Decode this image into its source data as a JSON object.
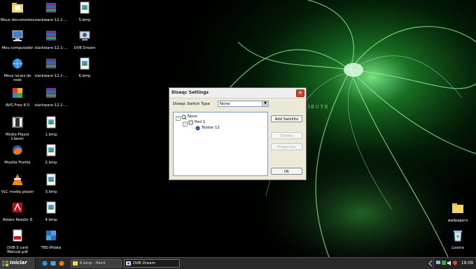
{
  "desktop": {
    "icons": [
      {
        "label": "Meus documentos",
        "icon": "folder-documents-icon"
      },
      {
        "label": "slackware-12.1-...",
        "icon": "archive-icon"
      },
      {
        "label": "5.bmp",
        "icon": "bitmap-icon"
      },
      {
        "label": "Meu computador",
        "icon": "computer-icon"
      },
      {
        "label": "slackware-12.1-...",
        "icon": "archive-icon"
      },
      {
        "label": "DVB Dream",
        "icon": "dvb-dream-icon"
      },
      {
        "label": "Meus locais de rede",
        "icon": "network-places-icon"
      },
      {
        "label": "slackware-12.1-...",
        "icon": "archive-icon"
      },
      {
        "label": "6.bmp",
        "icon": "bitmap-icon"
      },
      {
        "label": "AVG Free 8.0",
        "icon": "avg-icon"
      },
      {
        "label": "slackware-12.1-...",
        "icon": "archive-icon"
      },
      {
        "label": "Media Player Classic",
        "icon": "media-player-icon"
      },
      {
        "label": "1.bmp",
        "icon": "bitmap-icon"
      },
      {
        "label": "Mozilla Firefox",
        "icon": "firefox-icon"
      },
      {
        "label": "2.bmp",
        "icon": "bitmap-icon"
      },
      {
        "label": "VLC media player",
        "icon": "vlc-icon"
      },
      {
        "label": "3.bmp",
        "icon": "bitmap-icon"
      },
      {
        "label": "Adobe Reader 8",
        "icon": "adobe-reader-icon"
      },
      {
        "label": "4.bmp",
        "icon": "bitmap-icon"
      },
      {
        "label": "DVB-S card Manual.pdf",
        "icon": "pdf-icon"
      },
      {
        "label": "TBS-IPdata",
        "icon": "tbs-ipdata-icon"
      },
      {
        "label": "wallpapers",
        "icon": "folder-icon"
      },
      {
        "label": "Lixeira",
        "icon": "recycle-bin-icon"
      }
    ],
    "wallpaper_text": "IBUTE"
  },
  "dialog": {
    "title": "Diseqc Settings",
    "switch_type_label": "Diseqc Switch Type",
    "switch_type_value": "None",
    "tree": {
      "root": "None",
      "child": "Port 1",
      "leaf": "Telstar 12"
    },
    "buttons": {
      "add_satellite": "Add Satellite",
      "delete": "Delete",
      "properties": "Properties",
      "ok": "Ok"
    }
  },
  "taskbar": {
    "start_label": "Iniciar",
    "tasks": [
      {
        "label": "6.bmp - Paint",
        "active": false
      },
      {
        "label": "DVB Dream",
        "active": true
      }
    ],
    "clock": "19:09"
  },
  "colors": {
    "wallpaper_glow": "#39c94a",
    "dialog_bg": "#ece9d8",
    "taskbar_bg": "#2a2a2a",
    "close_button": "#c8432c"
  }
}
